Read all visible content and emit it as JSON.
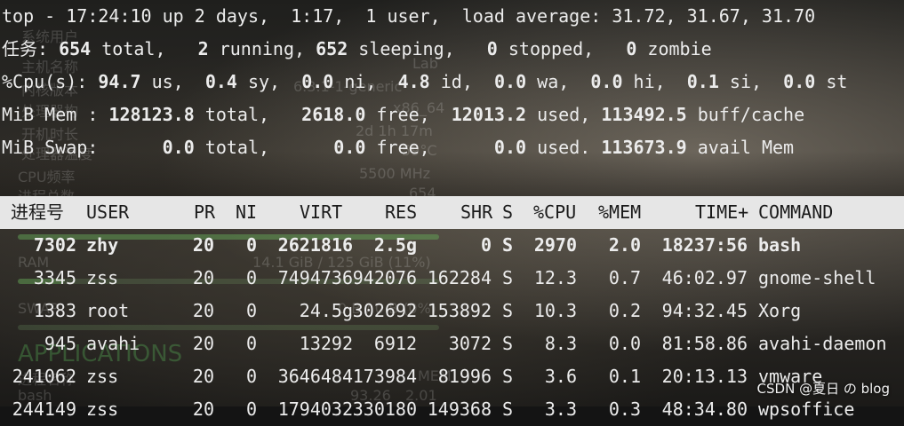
{
  "summary": {
    "uptime_line": "top - 17:24:10 up 2 days,  1:17,  1 user,  load average: 31.72, 31.67, 31.70",
    "tasks": {
      "label": "任务:",
      "total": "654",
      "total_label": " total,",
      "running": "2",
      "running_label": " running,",
      "sleeping": "652",
      "sleeping_label": " sleeping,",
      "stopped": "0",
      "stopped_label": " stopped,",
      "zombie": "0",
      "zombie_label": " zombie"
    },
    "cpu": {
      "label": "%Cpu(s):",
      "us": "94.7",
      "us_label": " us,",
      "sy": "0.4",
      "sy_label": " sy,",
      "ni": "0.0",
      "ni_label": " ni,",
      "id": "4.8",
      "id_label": " id,",
      "wa": "0.0",
      "wa_label": " wa,",
      "hi": "0.0",
      "hi_label": " hi,",
      "si": "0.1",
      "si_label": " si,",
      "st": "0.0",
      "st_label": " st"
    },
    "mem": {
      "label": "MiB Mem :",
      "total": "128123.8",
      "total_label": " total,",
      "free": "2618.0",
      "free_label": " free,",
      "used": "12013.2",
      "used_label": " used,",
      "buff": "113492.5",
      "buff_label": " buff/cache"
    },
    "swap": {
      "label": "MiB Swap:",
      "total": "0.0",
      "total_label": " total,",
      "free": "0.0",
      "free_label": " free,",
      "used": "0.0",
      "used_label": " used.",
      "avail": "113673.9",
      "avail_label": " avail Mem"
    }
  },
  "columns": [
    "进程号",
    "USER",
    "PR",
    "NI",
    "VIRT",
    "RES",
    "SHR",
    "S",
    "%CPU",
    "%MEM",
    "TIME+",
    "COMMAND"
  ],
  "processes": [
    {
      "pid": "7302",
      "user": "zhy",
      "pr": "20",
      "ni": "0",
      "virt": "2621816",
      "res": "2.5g",
      "shr": "0",
      "s": "S",
      "cpu": "2970",
      "mem": "2.0",
      "time": "18237:56",
      "cmd": "bash",
      "bold": true
    },
    {
      "pid": "3345",
      "user": "zss",
      "pr": "20",
      "ni": "0",
      "virt": "7494736",
      "res": "942076",
      "shr": "162284",
      "s": "S",
      "cpu": "12.3",
      "mem": "0.7",
      "time": "46:02.97",
      "cmd": "gnome-shell",
      "bold": false
    },
    {
      "pid": "1383",
      "user": "root",
      "pr": "20",
      "ni": "0",
      "virt": "24.5g",
      "res": "302692",
      "shr": "153892",
      "s": "S",
      "cpu": "10.3",
      "mem": "0.2",
      "time": "94:32.45",
      "cmd": "Xorg",
      "bold": false
    },
    {
      "pid": "945",
      "user": "avahi",
      "pr": "20",
      "ni": "0",
      "virt": "13292",
      "res": "6912",
      "shr": "3072",
      "s": "S",
      "cpu": "8.3",
      "mem": "0.0",
      "time": "81:58.86",
      "cmd": "avahi-daemon",
      "bold": false
    },
    {
      "pid": "241062",
      "user": "zss",
      "pr": "20",
      "ni": "0",
      "virt": "3646484",
      "res": "173984",
      "shr": "81996",
      "s": "S",
      "cpu": "3.6",
      "mem": "0.1",
      "time": "20:13.13",
      "cmd": "vmware",
      "bold": false
    },
    {
      "pid": "244149",
      "user": "zss",
      "pr": "20",
      "ni": "0",
      "virt": "1794032",
      "res": "330180",
      "shr": "149368",
      "s": "S",
      "cpu": "3.3",
      "mem": "0.3",
      "time": "48:34.80",
      "cmd": "wpsoffice",
      "bold": false
    }
  ],
  "background_overlay": {
    "labels": [
      "系统用户",
      "主机名称",
      "Lab",
      "内核版本",
      "6.3.1-1-generic",
      "处理器构",
      "x86_64",
      "开机时长",
      "2d 1h 17m",
      "处理器温度",
      "59°C",
      "CPU频率",
      "5500 MHz",
      "进程总数",
      "654",
      "RAM",
      "14.1 GiB / 125 GiB (11%)",
      "SWAP",
      "0 B / 0 B (0%)",
      "APPLICATIONS",
      "进程名称",
      "MEM",
      "bash",
      "93.26",
      "2.01"
    ],
    "ram_fraction": 0.11,
    "swap_fraction": 0.0
  },
  "watermark": "CSDN @夏日 の blog",
  "colors": {
    "terminal_text": "#ececec",
    "header_bg": "#e6e6e6",
    "header_text": "#1a1a1a",
    "overlay_green": "#5faa50"
  }
}
